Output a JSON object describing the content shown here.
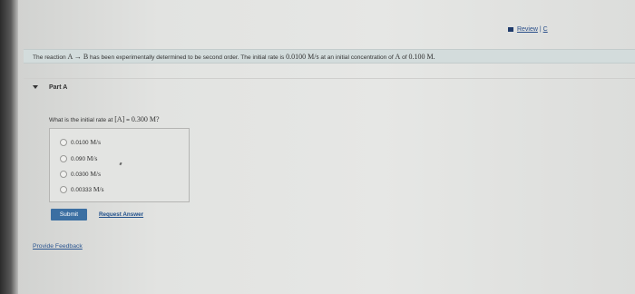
{
  "header": {
    "review_link": "Review",
    "sep": "|",
    "constants_link": "C"
  },
  "intro": {
    "text_before": "The reaction ",
    "reaction": "A → B",
    "text_mid": " has been experimentally determined to be second order. The initial rate is ",
    "rate": "0.0100 M/s",
    "text_mid2": " at an initial concentration of ",
    "species": "A",
    "text_end": " of ",
    "conc": "0.100 M."
  },
  "part": {
    "label": "Part A"
  },
  "question": {
    "prefix": "What is the initial rate at ",
    "species": "[A]",
    "eq": " = ",
    "value": "0.300 M?"
  },
  "answers": [
    {
      "value": "0.0100",
      "unit": "M/s"
    },
    {
      "value": "0.090",
      "unit": "M/s"
    },
    {
      "value": "0.0300",
      "unit": "M/s"
    },
    {
      "value": "0.00333",
      "unit": "M/s"
    }
  ],
  "actions": {
    "submit": "Submit",
    "request_answer": "Request Answer"
  },
  "feedback": {
    "label": "Provide Feedback"
  }
}
